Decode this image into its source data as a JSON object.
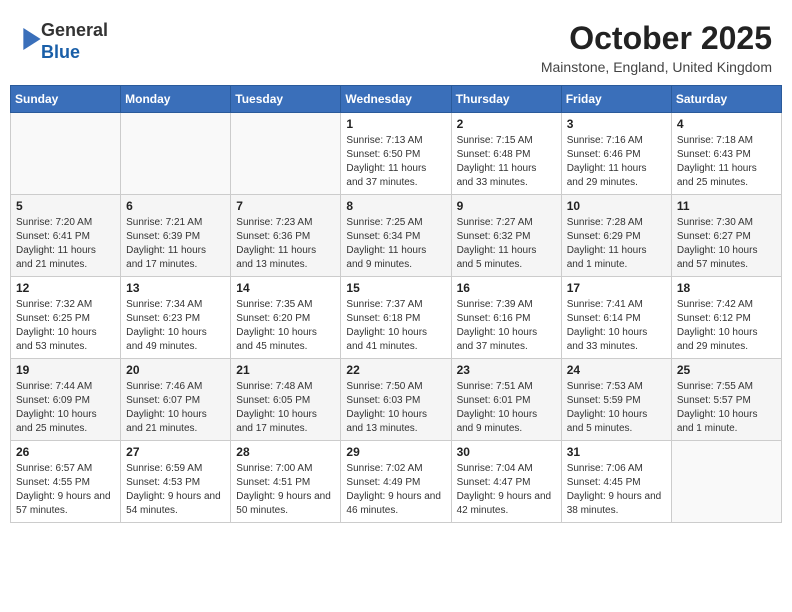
{
  "header": {
    "logo_line1": "General",
    "logo_line2": "Blue",
    "month": "October 2025",
    "location": "Mainstone, England, United Kingdom"
  },
  "weekdays": [
    "Sunday",
    "Monday",
    "Tuesday",
    "Wednesday",
    "Thursday",
    "Friday",
    "Saturday"
  ],
  "weeks": [
    {
      "days": [
        {
          "number": "",
          "empty": true
        },
        {
          "number": "",
          "empty": true
        },
        {
          "number": "",
          "empty": true
        },
        {
          "number": "1",
          "sunrise": "7:13 AM",
          "sunset": "6:50 PM",
          "daylight": "11 hours and 37 minutes."
        },
        {
          "number": "2",
          "sunrise": "7:15 AM",
          "sunset": "6:48 PM",
          "daylight": "11 hours and 33 minutes."
        },
        {
          "number": "3",
          "sunrise": "7:16 AM",
          "sunset": "6:46 PM",
          "daylight": "11 hours and 29 minutes."
        },
        {
          "number": "4",
          "sunrise": "7:18 AM",
          "sunset": "6:43 PM",
          "daylight": "11 hours and 25 minutes."
        }
      ]
    },
    {
      "days": [
        {
          "number": "5",
          "sunrise": "7:20 AM",
          "sunset": "6:41 PM",
          "daylight": "11 hours and 21 minutes."
        },
        {
          "number": "6",
          "sunrise": "7:21 AM",
          "sunset": "6:39 PM",
          "daylight": "11 hours and 17 minutes."
        },
        {
          "number": "7",
          "sunrise": "7:23 AM",
          "sunset": "6:36 PM",
          "daylight": "11 hours and 13 minutes."
        },
        {
          "number": "8",
          "sunrise": "7:25 AM",
          "sunset": "6:34 PM",
          "daylight": "11 hours and 9 minutes."
        },
        {
          "number": "9",
          "sunrise": "7:27 AM",
          "sunset": "6:32 PM",
          "daylight": "11 hours and 5 minutes."
        },
        {
          "number": "10",
          "sunrise": "7:28 AM",
          "sunset": "6:29 PM",
          "daylight": "11 hours and 1 minute."
        },
        {
          "number": "11",
          "sunrise": "7:30 AM",
          "sunset": "6:27 PM",
          "daylight": "10 hours and 57 minutes."
        }
      ]
    },
    {
      "days": [
        {
          "number": "12",
          "sunrise": "7:32 AM",
          "sunset": "6:25 PM",
          "daylight": "10 hours and 53 minutes."
        },
        {
          "number": "13",
          "sunrise": "7:34 AM",
          "sunset": "6:23 PM",
          "daylight": "10 hours and 49 minutes."
        },
        {
          "number": "14",
          "sunrise": "7:35 AM",
          "sunset": "6:20 PM",
          "daylight": "10 hours and 45 minutes."
        },
        {
          "number": "15",
          "sunrise": "7:37 AM",
          "sunset": "6:18 PM",
          "daylight": "10 hours and 41 minutes."
        },
        {
          "number": "16",
          "sunrise": "7:39 AM",
          "sunset": "6:16 PM",
          "daylight": "10 hours and 37 minutes."
        },
        {
          "number": "17",
          "sunrise": "7:41 AM",
          "sunset": "6:14 PM",
          "daylight": "10 hours and 33 minutes."
        },
        {
          "number": "18",
          "sunrise": "7:42 AM",
          "sunset": "6:12 PM",
          "daylight": "10 hours and 29 minutes."
        }
      ]
    },
    {
      "days": [
        {
          "number": "19",
          "sunrise": "7:44 AM",
          "sunset": "6:09 PM",
          "daylight": "10 hours and 25 minutes."
        },
        {
          "number": "20",
          "sunrise": "7:46 AM",
          "sunset": "6:07 PM",
          "daylight": "10 hours and 21 minutes."
        },
        {
          "number": "21",
          "sunrise": "7:48 AM",
          "sunset": "6:05 PM",
          "daylight": "10 hours and 17 minutes."
        },
        {
          "number": "22",
          "sunrise": "7:50 AM",
          "sunset": "6:03 PM",
          "daylight": "10 hours and 13 minutes."
        },
        {
          "number": "23",
          "sunrise": "7:51 AM",
          "sunset": "6:01 PM",
          "daylight": "10 hours and 9 minutes."
        },
        {
          "number": "24",
          "sunrise": "7:53 AM",
          "sunset": "5:59 PM",
          "daylight": "10 hours and 5 minutes."
        },
        {
          "number": "25",
          "sunrise": "7:55 AM",
          "sunset": "5:57 PM",
          "daylight": "10 hours and 1 minute."
        }
      ]
    },
    {
      "days": [
        {
          "number": "26",
          "sunrise": "6:57 AM",
          "sunset": "4:55 PM",
          "daylight": "9 hours and 57 minutes."
        },
        {
          "number": "27",
          "sunrise": "6:59 AM",
          "sunset": "4:53 PM",
          "daylight": "9 hours and 54 minutes."
        },
        {
          "number": "28",
          "sunrise": "7:00 AM",
          "sunset": "4:51 PM",
          "daylight": "9 hours and 50 minutes."
        },
        {
          "number": "29",
          "sunrise": "7:02 AM",
          "sunset": "4:49 PM",
          "daylight": "9 hours and 46 minutes."
        },
        {
          "number": "30",
          "sunrise": "7:04 AM",
          "sunset": "4:47 PM",
          "daylight": "9 hours and 42 minutes."
        },
        {
          "number": "31",
          "sunrise": "7:06 AM",
          "sunset": "4:45 PM",
          "daylight": "9 hours and 38 minutes."
        },
        {
          "number": "",
          "empty": true
        }
      ]
    }
  ],
  "labels": {
    "sunrise_prefix": "Sunrise: ",
    "sunset_prefix": "Sunset: ",
    "daylight_prefix": "Daylight: "
  }
}
